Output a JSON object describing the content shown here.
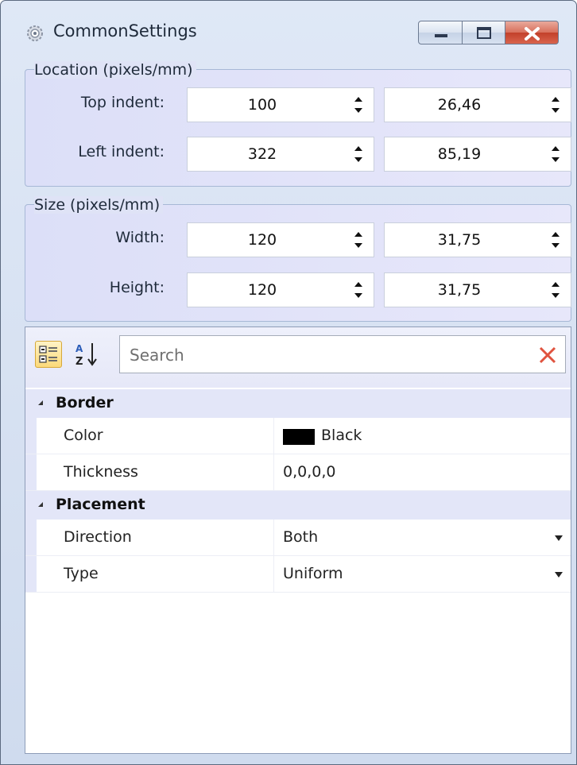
{
  "window": {
    "title": "CommonSettings"
  },
  "location": {
    "title": "Location (pixels/mm)",
    "rows": [
      {
        "label": "Top indent:",
        "pixels": "100",
        "mm": "26,46"
      },
      {
        "label": "Left indent:",
        "pixels": "322",
        "mm": "85,19"
      }
    ]
  },
  "size": {
    "title": "Size (pixels/mm)",
    "rows": [
      {
        "label": "Width:",
        "pixels": "120",
        "mm": "31,75"
      },
      {
        "label": "Height:",
        "pixels": "120",
        "mm": "31,75"
      }
    ]
  },
  "property_grid": {
    "search_placeholder": "Search",
    "categories": [
      {
        "name": "Border",
        "properties": [
          {
            "name": "Color",
            "value": "Black",
            "swatch": "#000000"
          },
          {
            "name": "Thickness",
            "value": "0,0,0,0"
          }
        ]
      },
      {
        "name": "Placement",
        "properties": [
          {
            "name": "Direction",
            "value": "Both"
          },
          {
            "name": "Type",
            "value": "Uniform"
          }
        ]
      }
    ]
  },
  "colors": {
    "accent": "#c2402a",
    "group_bg": "#e3e6f8"
  },
  "icons": [
    "settings-icon",
    "minimize-icon",
    "maximize-icon",
    "close-icon",
    "categorized-icon",
    "sort-alpha-icon",
    "clear-search-icon",
    "spin-icon",
    "dropdown-arrow-icon"
  ]
}
